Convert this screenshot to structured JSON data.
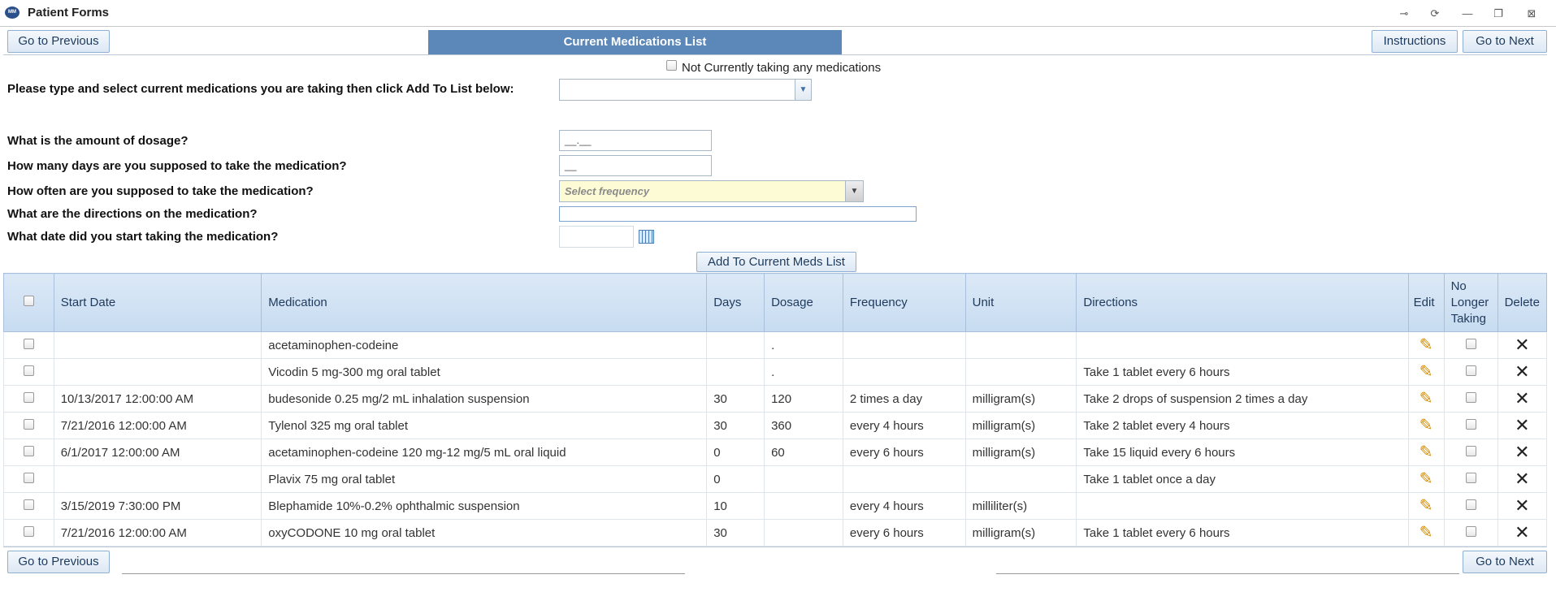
{
  "window": {
    "title": "Patient Forms",
    "logo_text": "MM"
  },
  "toolbar": {
    "prev_label": "Go to Previous",
    "header_title": "Current Medications List",
    "instructions_label": "Instructions",
    "next_label": "Go to Next"
  },
  "form": {
    "not_taking_label": "Not Currently taking any medications",
    "select_med_label": "Please type and select current medications you are taking then click Add To List below:",
    "dosage_label": "What is the amount of dosage?",
    "dosage_mask": "__.__",
    "days_label": "How many days are you supposed to take the medication?",
    "days_mask": "__",
    "frequency_label": "How often are you supposed to take the medication?",
    "frequency_placeholder": "Select frequency",
    "directions_label": "What are the directions on the medication?",
    "start_date_label": "What date did you start taking the medication?",
    "add_button_label": "Add To Current Meds List"
  },
  "grid": {
    "headers": {
      "start_date": "Start Date",
      "medication": "Medication",
      "days": "Days",
      "dosage": "Dosage",
      "frequency": "Frequency",
      "unit": "Unit",
      "directions": "Directions",
      "edit": "Edit",
      "no_longer_taking": "No Longer Taking",
      "delete": "Delete"
    },
    "rows": [
      {
        "start_date": "",
        "medication": "acetaminophen-codeine",
        "days": "",
        "dosage": ".",
        "frequency": "",
        "unit": "",
        "directions": ""
      },
      {
        "start_date": "",
        "medication": "Vicodin 5 mg-300 mg oral tablet",
        "days": "",
        "dosage": ".",
        "frequency": "",
        "unit": "",
        "directions": "Take 1 tablet every 6 hours"
      },
      {
        "start_date": "10/13/2017 12:00:00 AM",
        "medication": "budesonide 0.25 mg/2 mL inhalation suspension",
        "days": "30",
        "dosage": "120",
        "frequency": "2 times a day",
        "unit": "milligram(s)",
        "directions": "Take 2 drops of suspension 2 times a day"
      },
      {
        "start_date": "7/21/2016 12:00:00 AM",
        "medication": "Tylenol 325 mg oral tablet",
        "days": "30",
        "dosage": "360",
        "frequency": "every 4 hours",
        "unit": "milligram(s)",
        "directions": "Take 2 tablet every 4 hours"
      },
      {
        "start_date": "6/1/2017 12:00:00 AM",
        "medication": "acetaminophen-codeine 120 mg-12 mg/5 mL oral liquid",
        "days": "0",
        "dosage": "60",
        "frequency": "every 6 hours",
        "unit": "milligram(s)",
        "directions": "Take 15 liquid every 6 hours"
      },
      {
        "start_date": "",
        "medication": "Plavix 75 mg oral tablet",
        "days": "0",
        "dosage": "",
        "frequency": "",
        "unit": "",
        "directions": "Take 1 tablet once a day"
      },
      {
        "start_date": "3/15/2019 7:30:00 PM",
        "medication": "Blephamide 10%-0.2% ophthalmic suspension",
        "days": "10",
        "dosage": "",
        "frequency": "every 4 hours",
        "unit": "milliliter(s)",
        "directions": ""
      },
      {
        "start_date": "7/21/2016 12:00:00 AM",
        "medication": "oxyCODONE 10 mg oral tablet",
        "days": "30",
        "dosage": "",
        "frequency": "every 6 hours",
        "unit": "milligram(s)",
        "directions": "Take 1 tablet every 6 hours"
      }
    ]
  },
  "footer": {
    "prev_label": "Go to Previous",
    "next_label": "Go to Next"
  },
  "colors": {
    "header_tab": "#5b88b8",
    "grid_header": "#c7dcf1",
    "frequency_bg": "#fdfbd5",
    "edit_icon": "#d28a00"
  },
  "icons": {
    "window_controls": [
      "pin-icon",
      "refresh-icon",
      "minimize-icon",
      "restore-icon",
      "close-icon"
    ]
  }
}
